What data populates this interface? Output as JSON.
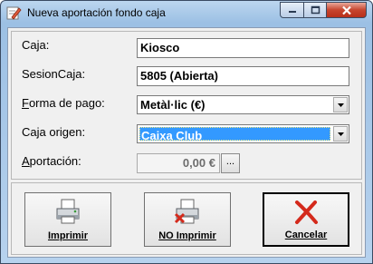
{
  "window": {
    "title": "Nueva aportación fondo caja"
  },
  "form": {
    "caja_label": "Caja:",
    "caja_value": "Kiosco",
    "sesion_label": "SesionCaja:",
    "sesion_value": "5805 (Abierta)",
    "forma_pago_label_accel": "F",
    "forma_pago_label_rest": "orma de pago:",
    "forma_pago_value": "Metàl·lic (€)",
    "caja_origen_label": "Caja origen:",
    "caja_origen_value": "Caixa Club",
    "aportacion_label_accel": "A",
    "aportacion_label_rest": "portación:",
    "aportacion_value": "0,00 €",
    "ellipsis_label": "..."
  },
  "buttons": {
    "imprimir_label": "Imprimir",
    "no_imprimir_label": "NO Imprimir",
    "cancelar_label": "Cancelar"
  },
  "colors": {
    "selection": "#3399ff",
    "close_button": "#c7452e",
    "cancel_icon": "#d42a1c"
  }
}
